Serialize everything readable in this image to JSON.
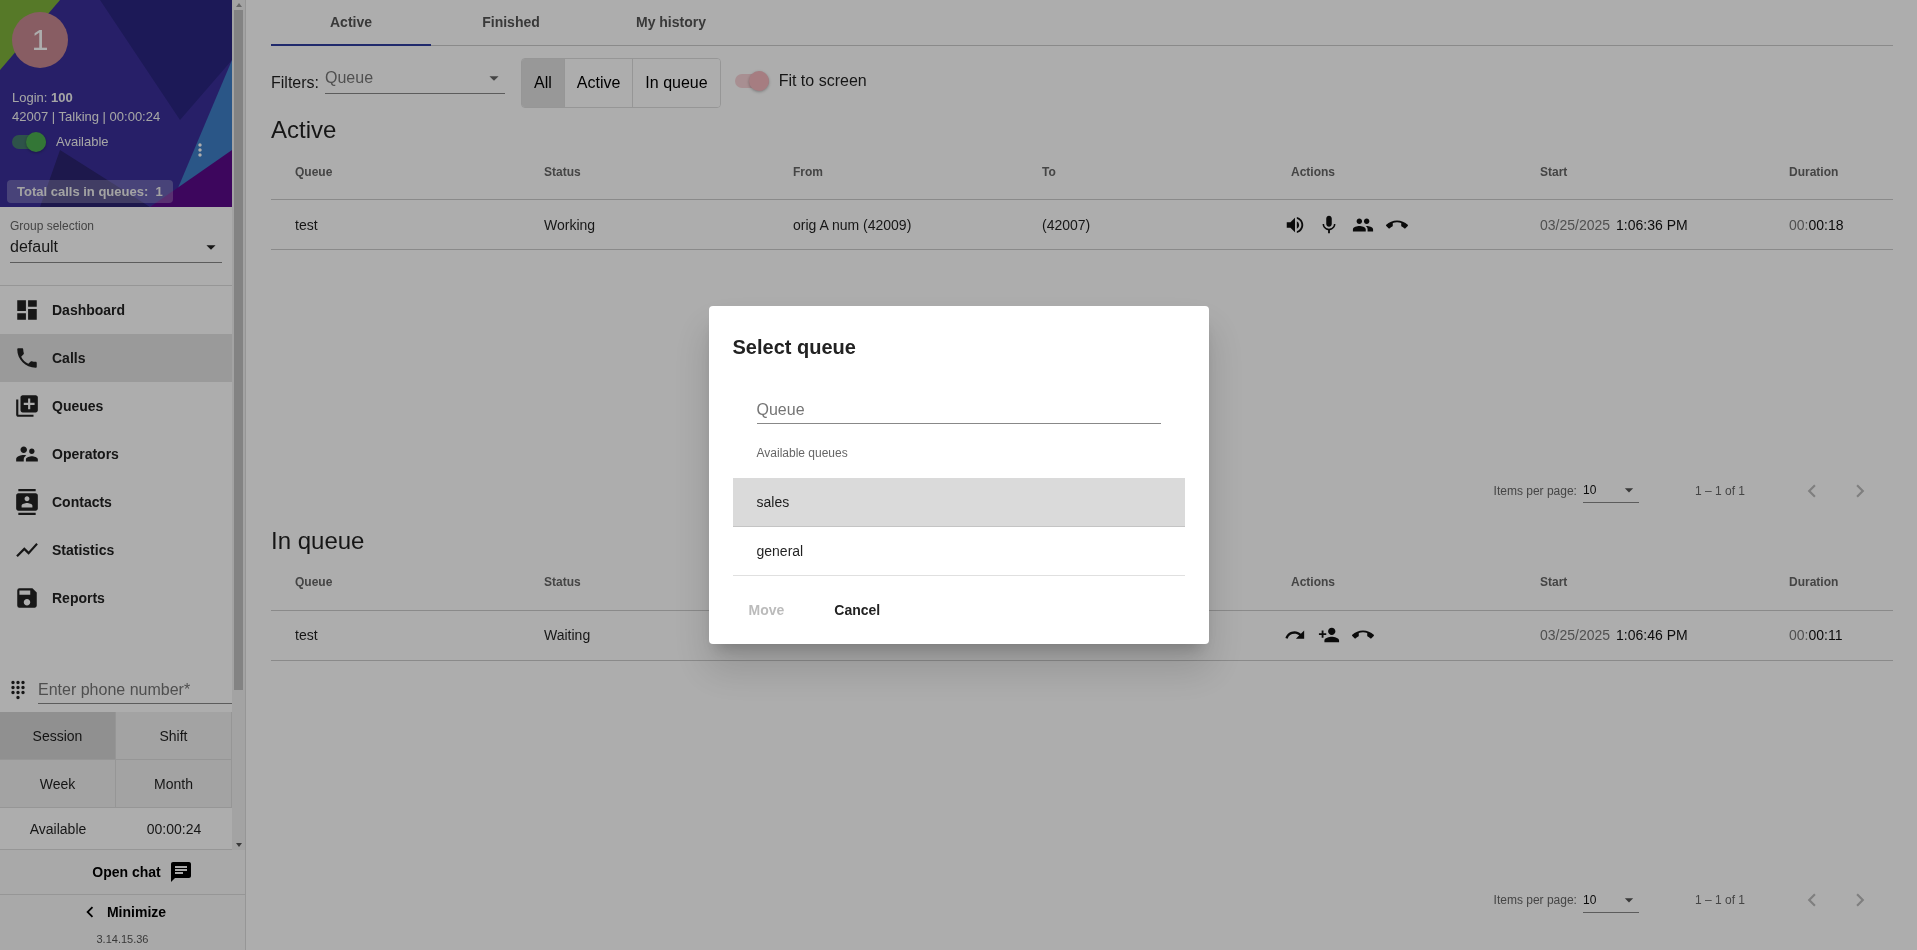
{
  "sidebar": {
    "profile": {
      "avatar": "1",
      "login_label": "Login:",
      "login": "100",
      "status_line": "42007 | Talking | 00:00:24",
      "available": {
        "label": "Available",
        "on": true
      },
      "total_calls": "Total calls in queues:  1"
    },
    "group": {
      "label": "Group selection",
      "value": "default"
    },
    "nav": [
      {
        "label": "Dashboard",
        "kind": "dashboard",
        "selected": false
      },
      {
        "label": "Calls",
        "kind": "phone",
        "selected": true
      },
      {
        "label": "Queues",
        "kind": "queue",
        "selected": false
      },
      {
        "label": "Operators",
        "kind": "operators",
        "selected": false
      },
      {
        "label": "Contacts",
        "kind": "contacts",
        "selected": false
      },
      {
        "label": "Statistics",
        "kind": "statistics",
        "selected": false
      },
      {
        "label": "Reports",
        "kind": "reports",
        "selected": false
      }
    ],
    "phone": {
      "placeholder": "Enter phone number*"
    },
    "periods": [
      {
        "label": "Session",
        "selected": true
      },
      {
        "label": "Shift",
        "selected": false
      },
      {
        "label": "Week",
        "selected": false
      },
      {
        "label": "Month",
        "selected": false
      }
    ],
    "summary": {
      "label": "Available",
      "value": "00:00:24"
    },
    "open_chat": "Open chat",
    "minimize": "Minimize",
    "version": "3.14.15.36"
  },
  "tabs": [
    {
      "label": "Active",
      "selected": true
    },
    {
      "label": "Finished",
      "selected": false
    },
    {
      "label": "My history",
      "selected": false
    }
  ],
  "filters": {
    "label": "Filters:",
    "queue": {
      "placeholder": "Queue"
    },
    "buttons": [
      {
        "label": "All",
        "selected": true
      },
      {
        "label": "Active",
        "selected": false
      },
      {
        "label": "In queue",
        "selected": false
      }
    ],
    "fit": {
      "label": "Fit to screen",
      "on": true
    }
  },
  "sections": [
    {
      "title": "Active",
      "columns": [
        {
          "kind": "queue",
          "label": "Queue"
        },
        {
          "kind": "status",
          "label": "Status"
        },
        {
          "kind": "from",
          "label": "From"
        },
        {
          "kind": "to",
          "label": "To"
        },
        {
          "kind": "actions",
          "label": "Actions"
        },
        {
          "kind": "start",
          "label": "Start"
        },
        {
          "kind": "duration",
          "label": "Duration"
        }
      ],
      "rows": [
        {
          "queue": "test",
          "status": "Working",
          "from": "orig A num (42009)",
          "to": "(42007)",
          "actions": [
            {
              "kind": "speaker"
            },
            {
              "kind": "mic"
            },
            {
              "kind": "people"
            },
            {
              "kind": "hangup"
            }
          ],
          "start_date": "03/25/2025",
          "start_time": "1:06:36 PM",
          "duration_prefix": "00:",
          "duration": "00:18"
        }
      ],
      "pagination": {
        "label": "Items per page:",
        "per_page": "10",
        "range": "1 – 1 of 1"
      }
    },
    {
      "title": "In queue",
      "columns": [
        {
          "kind": "queue",
          "label": "Queue"
        },
        {
          "kind": "status",
          "label": "Status"
        },
        {
          "kind": "actions",
          "label": "Actions"
        },
        {
          "kind": "start",
          "label": "Start"
        },
        {
          "kind": "duration",
          "label": "Duration"
        }
      ],
      "rows": [
        {
          "queue": "test",
          "status": "Waiting",
          "actions": [
            {
              "kind": "forward"
            },
            {
              "kind": "add-person"
            },
            {
              "kind": "hangup"
            }
          ],
          "start_date": "03/25/2025",
          "start_time": "1:06:46 PM",
          "duration_prefix": "00:",
          "duration": "00:11"
        }
      ],
      "pagination": {
        "label": "Items per page:",
        "per_page": "10",
        "range": "1 – 1 of 1"
      }
    }
  ],
  "dialog": {
    "title": "Select queue",
    "search": {
      "placeholder": "Queue"
    },
    "list_label": "Available queues",
    "queues": [
      {
        "label": "sales",
        "selected": true
      },
      {
        "label": "general",
        "selected": false
      }
    ],
    "buttons": [
      {
        "label": "Move",
        "disabled": true
      },
      {
        "label": "Cancel",
        "disabled": false
      }
    ]
  }
}
